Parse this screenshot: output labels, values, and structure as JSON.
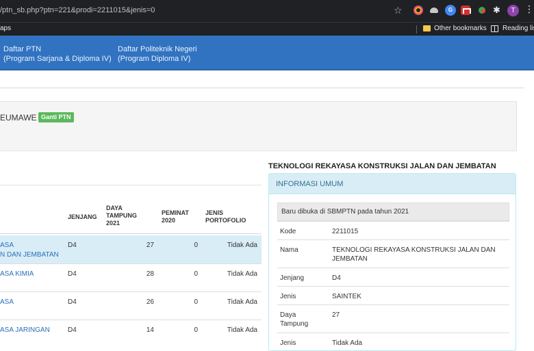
{
  "browser": {
    "url": "/ptn_sb.php?ptn=221&prodi=2211015&jenis=0",
    "apps_label": "aps",
    "other_bookmarks": "Other bookmarks",
    "reading_list": "Reading list",
    "profile_initial": "T"
  },
  "nav": {
    "ptn_line1": "Daftar PTN",
    "ptn_line2": "(Program Sarjana & Diploma IV)",
    "poli_line1": "Daftar Politeknik Negeri",
    "poli_line2": "(Program Diploma IV)"
  },
  "university": {
    "name_partial": "EUMAWE |",
    "ganti_button": "Ganti PTN"
  },
  "table": {
    "headers": {
      "jenjang": "JENJANG",
      "daya_1": "DAYA",
      "daya_2": "TAMPUNG",
      "daya_3": "2021",
      "peminat_1": "PEMINAT",
      "peminat_2": "2020",
      "porto_1": "JENIS",
      "porto_2": "PORTOFOLIO"
    },
    "rows": [
      {
        "name1": "ASA",
        "name2": "N DAN JEMBATAN",
        "jenjang": "D4",
        "daya": "27",
        "peminat": "0",
        "portofolio": "Tidak Ada"
      },
      {
        "name1": "ASA KIMIA",
        "name2": "",
        "jenjang": "D4",
        "daya": "28",
        "peminat": "0",
        "portofolio": "Tidak Ada"
      },
      {
        "name1": "ASA",
        "name2": "",
        "jenjang": "D4",
        "daya": "26",
        "peminat": "0",
        "portofolio": "Tidak Ada"
      },
      {
        "name1": "ASA JARINGAN",
        "name2": "",
        "jenjang": "D4",
        "daya": "14",
        "peminat": "0",
        "portofolio": "Tidak Ada"
      }
    ]
  },
  "detail": {
    "title": "TEKNOLOGI REKAYASA KONSTRUKSI JALAN DAN JEMBATAN",
    "panel_title": "INFORMASI UMUM",
    "notice": "Baru dibuka di SBMPTN pada tahun 2021",
    "kode_label": "Kode",
    "kode_value": "2211015",
    "nama_label": "Nama",
    "nama_value1": "TEKNOLOGI REKAYASA KONSTRUKSI JALAN DAN",
    "nama_value2": "JEMBATAN",
    "jenjang_label": "Jenjang",
    "jenjang_value": "D4",
    "jenis_label": "Jenis",
    "jenis_value": "SAINTEK",
    "daya_label1": "Daya",
    "daya_label2": "Tampung",
    "daya_value": "27",
    "porto_label": "Jenis",
    "porto_value": "Tidak Ada"
  }
}
